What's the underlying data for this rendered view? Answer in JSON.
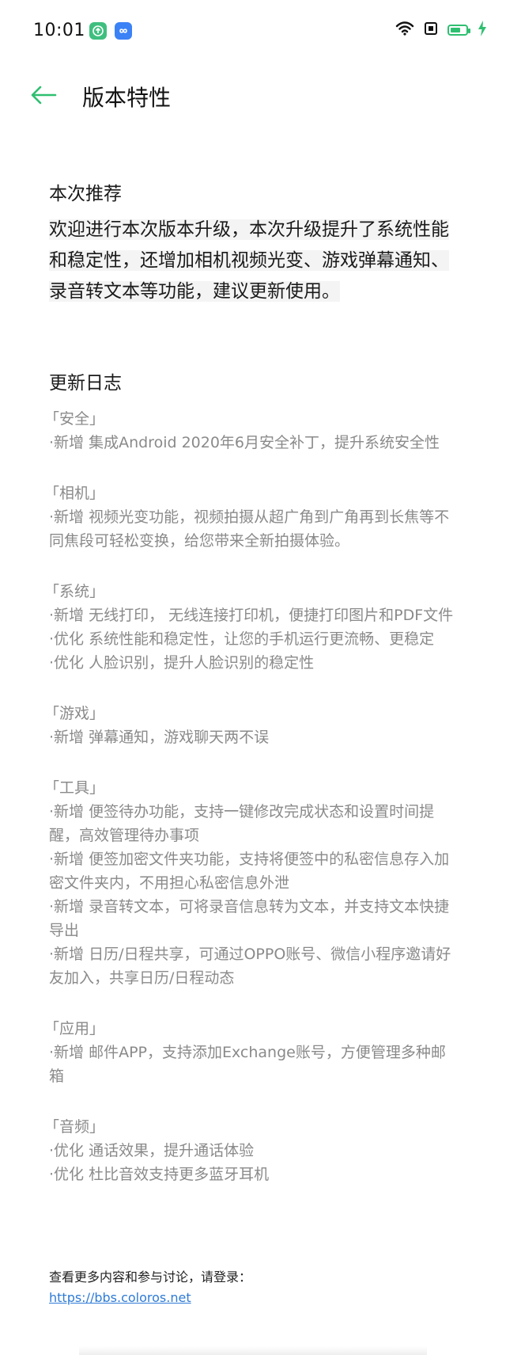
{
  "status_bar": {
    "time": "10:01",
    "notif_icons": [
      "upload-app-icon",
      "infinity-app-icon"
    ],
    "right_icons": [
      "wifi-icon",
      "sim-icon",
      "battery-charging-icon"
    ],
    "accent": "#2fbf71"
  },
  "nav": {
    "back_icon": "arrow-left-icon",
    "title": "版本特性",
    "accent": "#2fbf71"
  },
  "recommend": {
    "title": "本次推荐",
    "text": "欢迎进行本次版本升级，本次升级提升了系统性能和稳定性，还增加相机视频光变、游戏弹幕通知、录音转文本等功能，建议更新使用。"
  },
  "changelog": {
    "title": "更新日志",
    "groups": [
      {
        "category": "「安全」",
        "items": [
          "·新增 集成Android 2020年6月安全补丁，提升系统安全性"
        ]
      },
      {
        "category": "「相机」",
        "items": [
          "·新增 视频光变功能，视频拍摄从超广角到广角再到长焦等不同焦段可轻松变换，给您带来全新拍摄体验。"
        ]
      },
      {
        "category": "「系统」",
        "items": [
          "·新增 无线打印， 无线连接打印机，便捷打印图片和PDF文件",
          "·优化 系统性能和稳定性，让您的手机运行更流畅、更稳定",
          "·优化 人脸识别，提升人脸识别的稳定性"
        ]
      },
      {
        "category": "「游戏」",
        "items": [
          "·新增 弹幕通知，游戏聊天两不误"
        ]
      },
      {
        "category": "「工具」",
        "items": [
          "·新增 便签待办功能，支持一键修改完成状态和设置时间提醒，高效管理待办事项",
          "·新增 便签加密文件夹功能，支持将便签中的私密信息存入加密文件夹内，不用担心私密信息外泄",
          "·新增 录音转文本，可将录音信息转为文本，并支持文本快捷导出",
          "·新增 日历/日程共享，可通过OPPO账号、微信小程序邀请好友加入，共享日历/日程动态"
        ]
      },
      {
        "category": "「应用」",
        "items": [
          "·新增 邮件APP，支持添加Exchange账号，方便管理多种邮箱"
        ]
      },
      {
        "category": "「音频」",
        "items": [
          "·优化 通话效果，提升通话体验",
          "·优化 杜比音效支持更多蓝牙耳机"
        ]
      }
    ]
  },
  "footer": {
    "prompt": "查看更多内容和参与讨论，请登录：",
    "link": "https://bbs.coloros.net",
    "link_color": "#2e7bd6"
  }
}
